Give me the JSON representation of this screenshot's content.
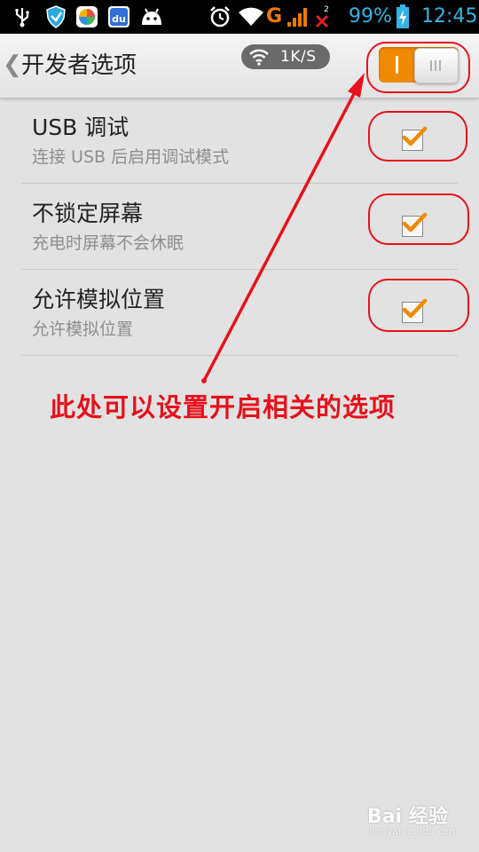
{
  "status_bar": {
    "battery_percent": "99%",
    "time": "12:45",
    "network_type": "G",
    "sim_slot": "2",
    "icons": [
      "usb-icon",
      "shield-icon",
      "app-store-icon",
      "baidu-icon",
      "android-icon",
      "alarm-icon",
      "wifi-icon",
      "signal-icon",
      "no-signal-icon",
      "battery-charging-icon"
    ],
    "baidu_icon_text": "du",
    "accent_color": "#33b5e5"
  },
  "action_bar": {
    "title": "开发者选项",
    "network_speed": "1K/S",
    "master_toggle_on": true,
    "toggle_color": "#f08a00"
  },
  "options": [
    {
      "title": "USB 调试",
      "subtitle": "连接 USB 后启用调试模式",
      "checked": true
    },
    {
      "title": "不锁定屏幕",
      "subtitle": "充电时屏幕不会休眠",
      "checked": true
    },
    {
      "title": "允许模拟位置",
      "subtitle": "允许模拟位置",
      "checked": true
    }
  ],
  "annotation": {
    "text": "此处可以设置开启相关的选项",
    "color": "#e8101c"
  },
  "watermark": {
    "main": "Bai 经验",
    "sub": "jingyan.baidu.com"
  }
}
